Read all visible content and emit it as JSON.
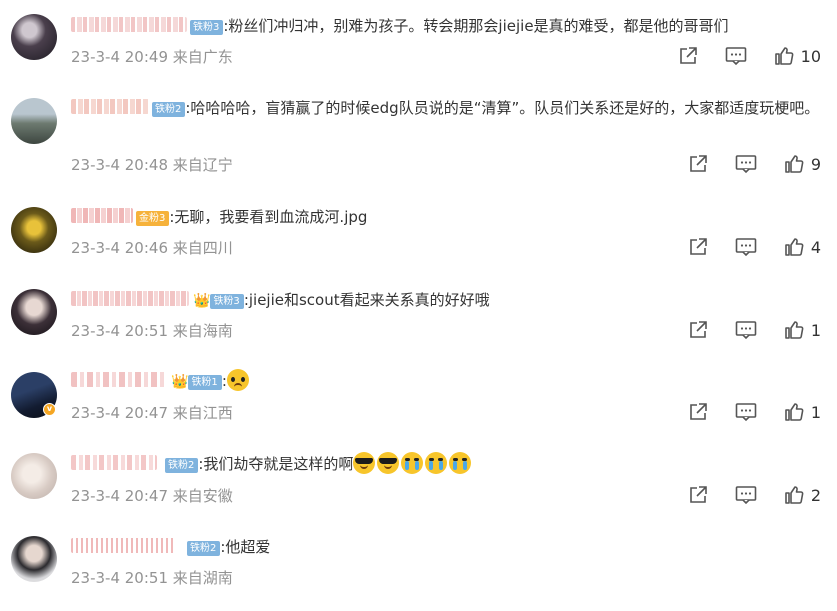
{
  "comments": [
    {
      "fan_badge": "铁粉3",
      "text": ":粉丝们冲归冲，别难为孩子。转会期那会jiejie是真的难受，都是他的哥哥们",
      "time": "23-3-4 20:49",
      "location": "来自广东",
      "likes": "10"
    },
    {
      "fan_badge": "铁粉2",
      "text": ":哈哈哈哈，盲猜赢了的时候edg队员说的是“清算”。队员们关系还是好的，大家都适度玩梗吧。",
      "time": "23-3-4 20:48",
      "location": "来自辽宁",
      "likes": "9"
    },
    {
      "fan_badge": "金粉3",
      "text": ":无聊，我要看到血流成河.jpg",
      "time": "23-3-4 20:46",
      "location": "来自四川",
      "likes": "4"
    },
    {
      "fan_badge": "铁粉3",
      "text": ":jiejie和scout看起来关系真的好好哦",
      "time": "23-3-4 20:51",
      "location": "来自海南",
      "likes": "1"
    },
    {
      "fan_badge": "铁粉1",
      "text": ":",
      "time": "23-3-4 20:47",
      "location": "来自江西",
      "likes": "1",
      "emojis": [
        "sad"
      ]
    },
    {
      "fan_badge": "铁粉2",
      "text": ":我们劫夺就是这样的啊",
      "time": "23-3-4 20:47",
      "location": "来自安徽",
      "likes": "2",
      "emojis": [
        "cool",
        "cool",
        "cry",
        "cry",
        "cry"
      ]
    },
    {
      "fan_badge": "铁粉2",
      "text": ":他超爱",
      "time": "23-3-4 20:51",
      "location": "来自湖南"
    }
  ],
  "icons": {
    "share": "share-icon",
    "comment": "comment-icon",
    "like": "thumbs-up-icon"
  },
  "colors": {
    "meta_text": "#939393",
    "iron_fan_badge": "#7fb3de",
    "gold_fan_badge": "#f6b23b"
  }
}
